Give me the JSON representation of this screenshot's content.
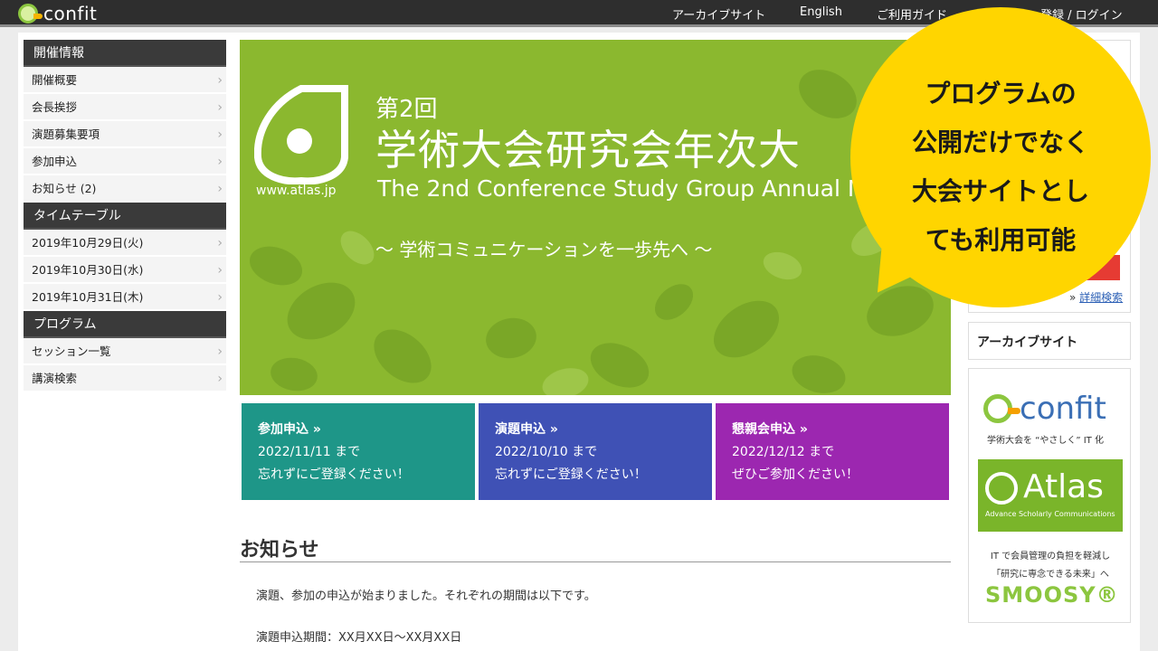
{
  "header": {
    "logo_text": "confit",
    "nav": [
      "アーカイブサイト",
      "English",
      "ご利用ガイド",
      "登録 / ログイン"
    ]
  },
  "sidebar": {
    "sections": [
      {
        "title": "開催情報",
        "items": [
          "開催概要",
          "会長挨拶",
          "演題募集要項",
          "参加申込",
          "お知らせ (2)"
        ]
      },
      {
        "title": "タイムテーブル",
        "items": [
          "2019年10月29日(火)",
          "2019年10月30日(水)",
          "2019年10月31日(木)"
        ]
      },
      {
        "title": "プログラム",
        "items": [
          "セッション一覧",
          "講演検索"
        ]
      }
    ]
  },
  "banner": {
    "url": "www.atlas.jp",
    "edition": "第2回",
    "title": "学術大会研究会年次大",
    "title_en": "The 2nd Conference Study Group Annual M",
    "tagline": "～ 学術コミュニケーションを一歩先へ ～"
  },
  "cards": [
    {
      "title": "参加申込 »",
      "line1": "2022/11/11 まで",
      "line2": "忘れずにご登録ください！",
      "color": "#1e9688"
    },
    {
      "title": "演題申込 »",
      "line1": "2022/10/10 まで",
      "line2": "忘れずにご登録ください！",
      "color": "#3f51b5"
    },
    {
      "title": "懇親会申込 »",
      "line1": "2022/12/12 まで",
      "line2": "ぜひご参加ください！",
      "color": "#9c27b0"
    }
  ],
  "notice": {
    "title": "お知らせ",
    "body": "演題、参加の申込が始まりました。それぞれの期間は以下です。",
    "period": "演題申込期間：XX月XX日〜XX月XX日"
  },
  "right": {
    "detail_prefix": "»",
    "detail_link": "詳細検索",
    "archive": "アーカイブサイト",
    "confit_logo": "confit",
    "confit_tag": "学術大会を “やさしく” IT 化",
    "atlas_name": "Atlas",
    "atlas_sub": "Advance Scholarly Communications",
    "smoosy_line1": "IT で会員管理の負担を軽減し",
    "smoosy_line2": "「研究に専念できる未来」へ",
    "smoosy_logo": "SMOOSY®"
  },
  "callout": {
    "lines": [
      "プログラムの",
      "公開だけでなく",
      "大会サイトとし",
      "ても利用可能"
    ],
    "color": "#ffd500"
  }
}
